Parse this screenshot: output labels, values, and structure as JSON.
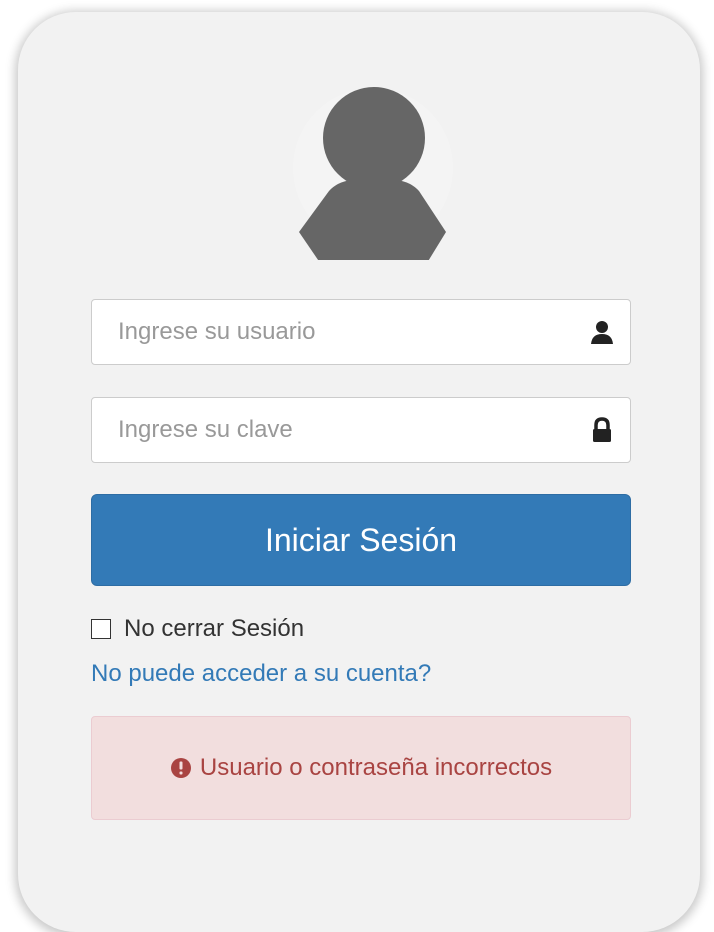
{
  "login": {
    "username_placeholder": "Ingrese su usuario",
    "username_icon": "user-icon",
    "password_placeholder": "Ingrese su clave",
    "password_icon": "lock-icon",
    "submit_label": "Iniciar Sesión",
    "remember_label": "No cerrar Sesión",
    "remember_checked": false,
    "forgot_link": "No puede acceder a su cuenta?",
    "error_icon": "exclamation-circle-icon",
    "error_message": "Usuario o contraseña incorrectos"
  },
  "colors": {
    "primary": "#337ab7",
    "error_text": "#a94442",
    "error_bg": "#f2dede",
    "card_bg": "#f2f2f2",
    "avatar": "#666666"
  }
}
